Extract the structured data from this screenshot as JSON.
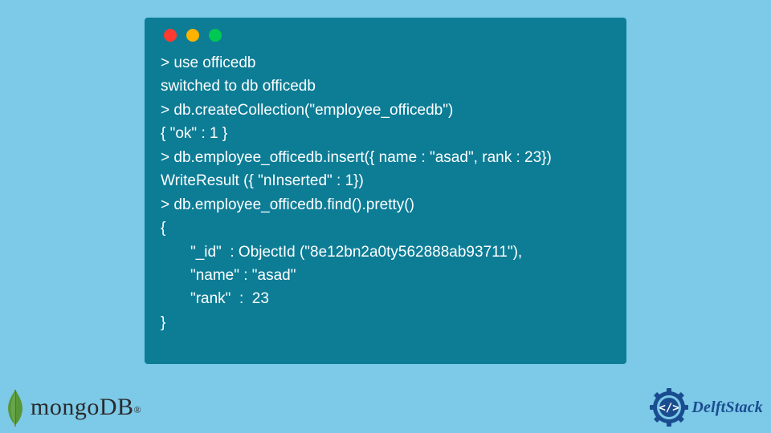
{
  "terminal": {
    "lines": [
      "> use officedb",
      "switched to db officedb",
      "> db.createCollection(\"employee_officedb\")",
      "{ \"ok\" : 1 }",
      "> db.employee_officedb.insert({ name : \"asad\", rank : 23})",
      "WriteResult ({ \"nInserted\" : 1})",
      "> db.employee_officedb.find().pretty()",
      "{",
      "       \"_id\"  : ObjectId (\"8e12bn2a0ty562888ab93711\"),",
      "       \"name\" : \"asad\"",
      "       \"rank\"  :  23",
      "}"
    ]
  },
  "branding": {
    "mongo": "mongoDB",
    "mongo_tm": "®",
    "delft": "DelftStack"
  },
  "colors": {
    "bg": "#7cc9e8",
    "terminal": "#0d7d96",
    "dot_red": "#ff3b30",
    "dot_yellow": "#ffb300",
    "dot_green": "#00c853",
    "delft_blue": "#1a4d8f",
    "mongo_leaf": "#589636"
  }
}
